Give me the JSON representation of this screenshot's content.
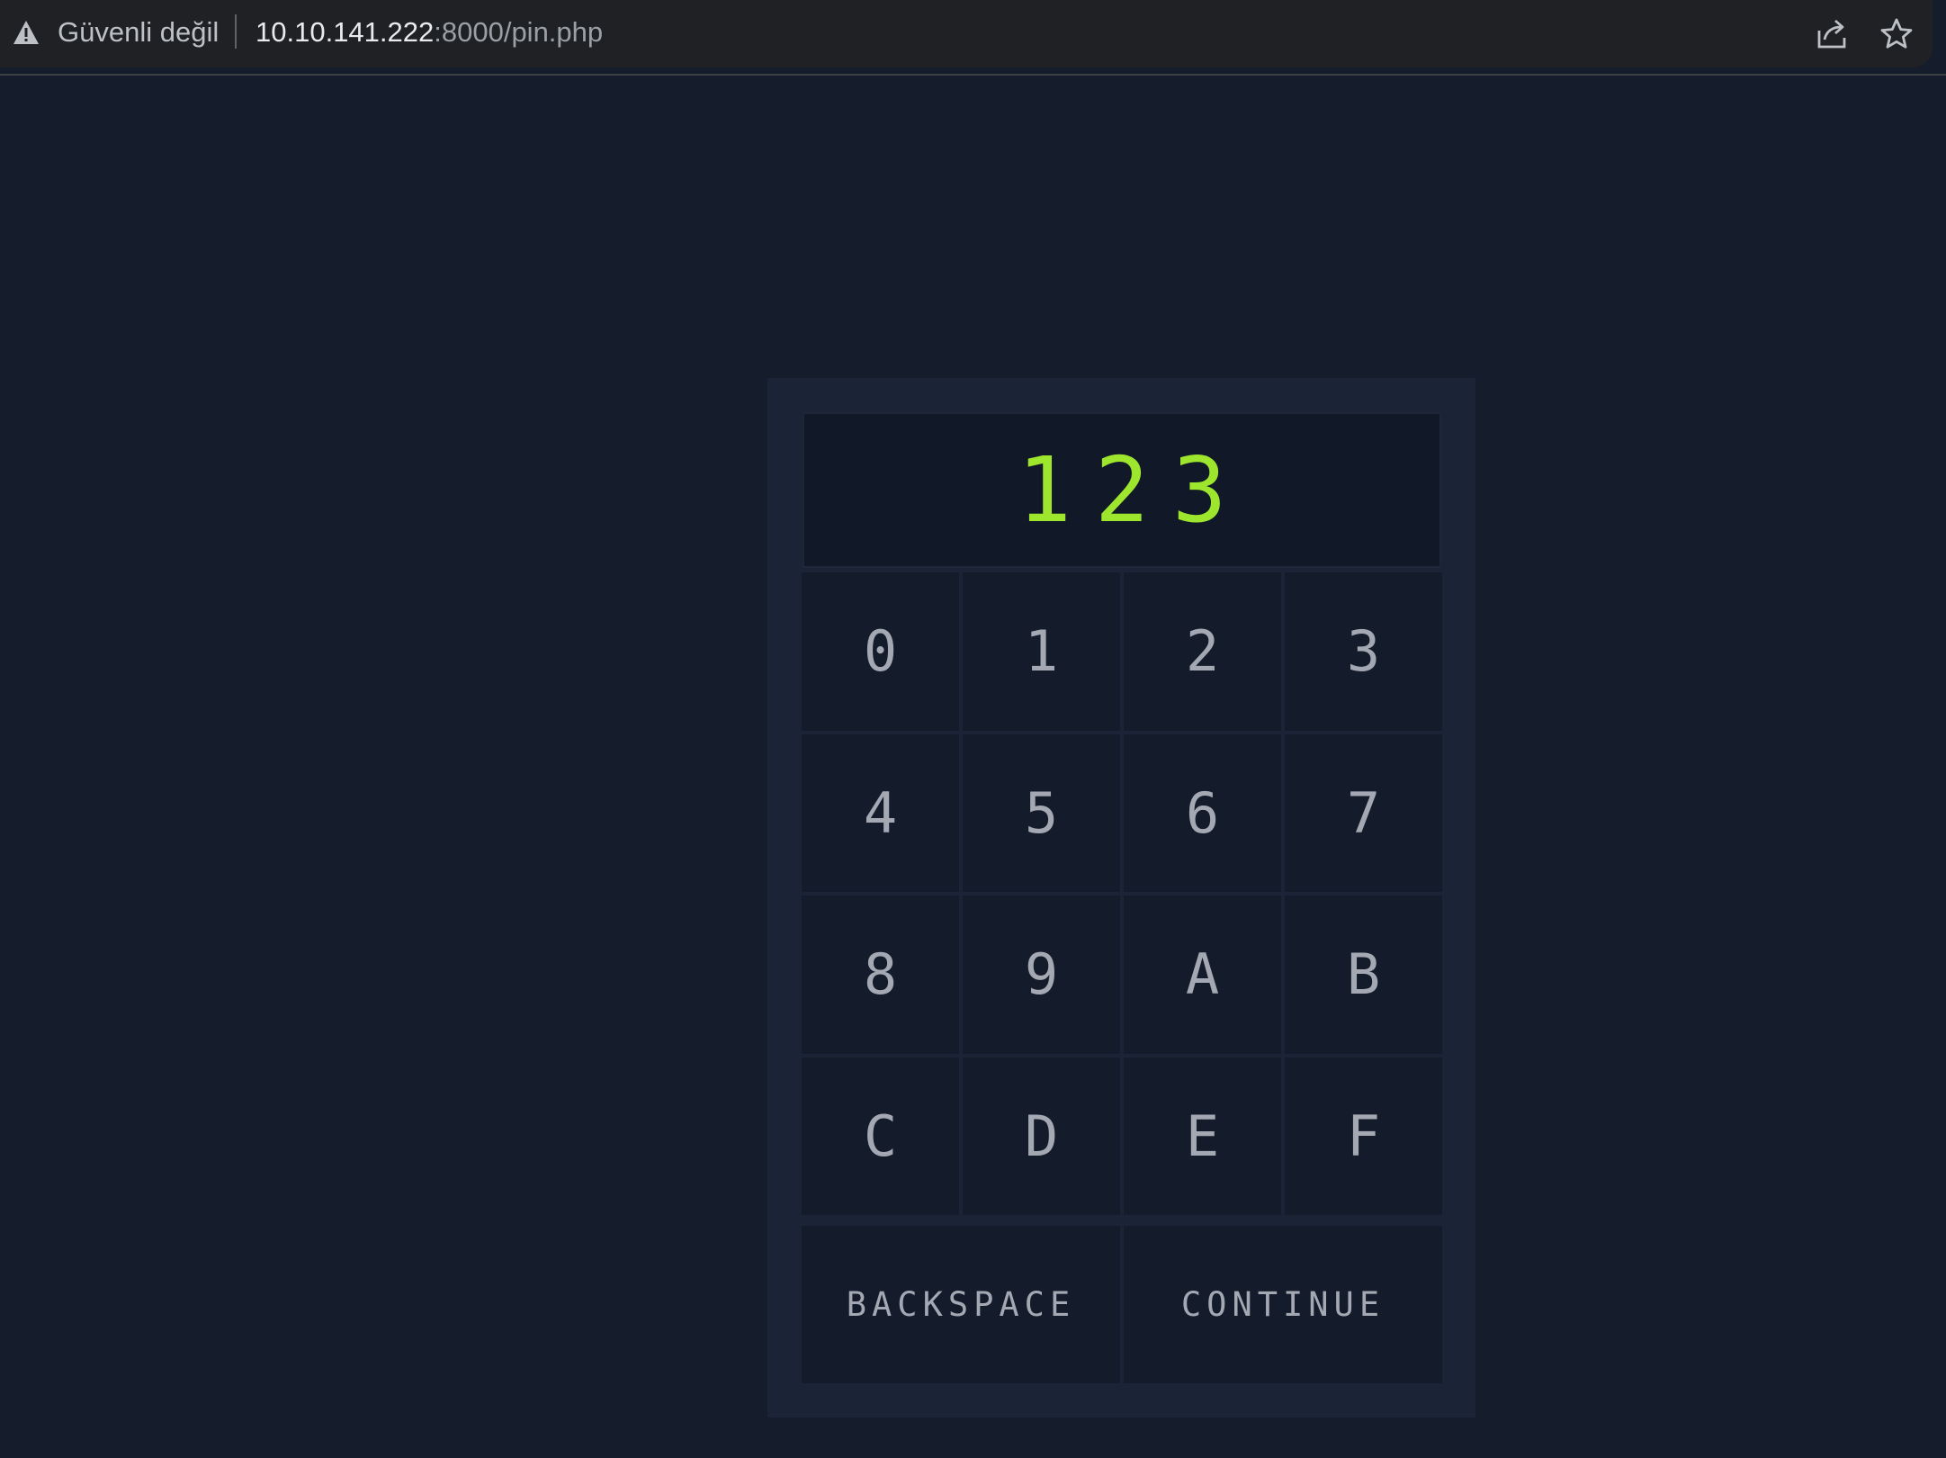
{
  "browser": {
    "security_label": "Güvenli değil",
    "url_host": "10.10.141.222",
    "url_path": ":8000/pin.php",
    "icons": [
      "warning-icon",
      "share-icon",
      "star-icon"
    ]
  },
  "pin": {
    "display_value": "123",
    "keys": [
      "0",
      "1",
      "2",
      "3",
      "4",
      "5",
      "6",
      "7",
      "8",
      "9",
      "A",
      "B",
      "C",
      "D",
      "E",
      "F"
    ],
    "backspace_label": "BACKSPACE",
    "continue_label": "CONTINUE"
  },
  "colors": {
    "page_bg": "#151c2c",
    "panel_bg": "#1b2336",
    "key_bg": "#141b2b",
    "display_text": "#9ee62e",
    "key_text": "#a4a8b3"
  }
}
